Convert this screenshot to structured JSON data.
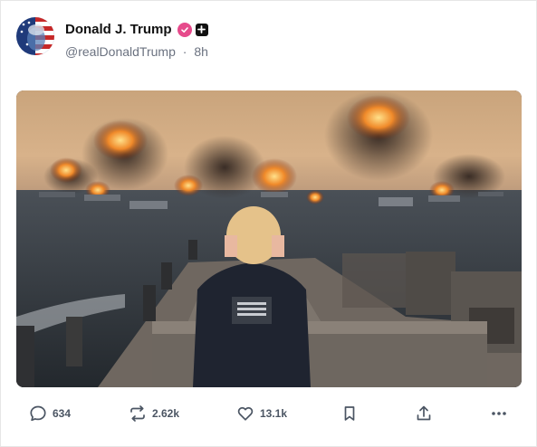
{
  "post": {
    "author_name": "Donald J. Trump",
    "handle": "@realDonaldTrump",
    "separator": "·",
    "time_ago": "8h"
  },
  "actions": {
    "replies": "634",
    "reposts": "2.62k",
    "likes": "13.1k"
  },
  "icons": {
    "verified": "verified-check-icon",
    "plus": "plus-badge-icon",
    "reply": "comment-icon",
    "repost": "repost-icon",
    "like": "heart-icon",
    "bookmark": "bookmark-icon",
    "share": "share-icon",
    "more": "more-horizontal-icon"
  },
  "colors": {
    "verified": "#e64a8b",
    "text_secondary": "#6b7280",
    "text_primary": "#111111"
  }
}
